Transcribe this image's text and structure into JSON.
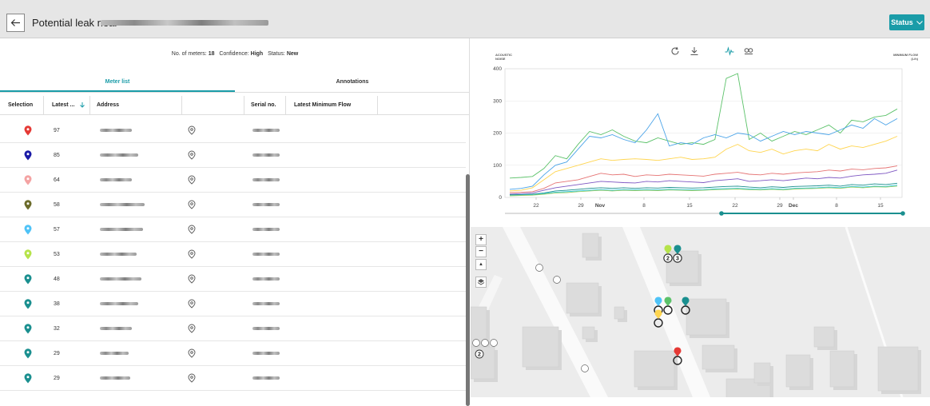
{
  "header": {
    "title": "Potential leak near",
    "status_button": "Status"
  },
  "summary": {
    "meters_label": "No. of meters:",
    "meters_value": "18",
    "confidence_label": "Confidence:",
    "confidence_value": "High",
    "status_label": "Status:",
    "status_value": "New"
  },
  "tabs": [
    {
      "label": "Meter list",
      "active": true
    },
    {
      "label": "Annotations",
      "active": false
    }
  ],
  "table": {
    "columns": [
      "Selection",
      "Latest ...",
      "Address",
      "",
      "Serial no.",
      "Latest Minimum Flow"
    ],
    "rows": [
      {
        "color": "#e53935",
        "value": "97"
      },
      {
        "color": "#1a1aa6",
        "value": "85"
      },
      {
        "color": "#f4a3a3",
        "value": "64"
      },
      {
        "color": "#6b6b2a",
        "value": "58"
      },
      {
        "color": "#4fc3f7",
        "value": "57"
      },
      {
        "color": "#b5e34a",
        "value": "53"
      },
      {
        "color": "#1a8f8f",
        "value": "48"
      },
      {
        "color": "#1a8f8f",
        "value": "38"
      },
      {
        "color": "#1a8f8f",
        "value": "32"
      },
      {
        "color": "#1a8f8f",
        "value": "29"
      },
      {
        "color": "#1a8f8f",
        "value": "29"
      }
    ]
  },
  "chart": {
    "left_axis_title": "ACOUSTIC NOISE",
    "right_axis_title": "MINIMUM FLOW (L/h)"
  },
  "chart_data": {
    "type": "line",
    "ylim": [
      0,
      400
    ],
    "yticks": [
      0,
      100,
      200,
      300,
      400
    ],
    "xtick_labels": [
      "22",
      "29",
      "Nov",
      "8",
      "15",
      "22",
      "29",
      "Dec",
      "8",
      "15"
    ],
    "grid": true,
    "series": [
      {
        "color": "#5cc26a",
        "values": [
          60,
          62,
          65,
          90,
          130,
          120,
          165,
          205,
          195,
          210,
          190,
          175,
          170,
          185,
          175,
          165,
          170,
          165,
          180,
          370,
          385,
          180,
          200,
          175,
          190,
          205,
          195,
          210,
          225,
          200,
          240,
          235,
          250,
          255,
          275
        ]
      },
      {
        "color": "#4aa3e8",
        "values": [
          25,
          28,
          35,
          70,
          100,
          110,
          150,
          190,
          185,
          195,
          180,
          170,
          210,
          260,
          160,
          170,
          165,
          185,
          195,
          185,
          200,
          195,
          175,
          190,
          205,
          195,
          205,
          200,
          195,
          210,
          225,
          215,
          245,
          225,
          245
        ]
      },
      {
        "color": "#ffd54f",
        "values": [
          20,
          22,
          30,
          55,
          80,
          90,
          100,
          110,
          120,
          115,
          118,
          120,
          118,
          115,
          120,
          125,
          118,
          120,
          125,
          150,
          165,
          145,
          140,
          150,
          135,
          145,
          150,
          145,
          165,
          150,
          160,
          155,
          165,
          175,
          190
        ]
      },
      {
        "color": "#e57373",
        "values": [
          15,
          16,
          18,
          28,
          45,
          50,
          55,
          65,
          75,
          70,
          72,
          65,
          70,
          68,
          72,
          70,
          68,
          66,
          72,
          75,
          78,
          72,
          70,
          75,
          72,
          76,
          78,
          80,
          85,
          82,
          88,
          86,
          90,
          92,
          98
        ]
      },
      {
        "color": "#7e57c2",
        "values": [
          10,
          12,
          14,
          22,
          30,
          35,
          40,
          45,
          50,
          48,
          46,
          45,
          50,
          48,
          52,
          50,
          48,
          46,
          52,
          55,
          58,
          50,
          52,
          55,
          52,
          56,
          60,
          58,
          62,
          60,
          66,
          70,
          72,
          75,
          85
        ]
      },
      {
        "color": "#1a8f8f",
        "values": [
          8,
          9,
          10,
          14,
          20,
          22,
          25,
          28,
          30,
          28,
          30,
          28,
          30,
          29,
          31,
          30,
          29,
          30,
          32,
          34,
          35,
          32,
          30,
          33,
          31,
          34,
          35,
          36,
          38,
          35,
          40,
          38,
          42,
          40,
          44
        ]
      },
      {
        "color": "#26c6da",
        "values": [
          6,
          7,
          8,
          12,
          16,
          18,
          20,
          22,
          24,
          22,
          24,
          23,
          24,
          23,
          25,
          24,
          23,
          24,
          26,
          27,
          28,
          26,
          25,
          27,
          25,
          28,
          29,
          30,
          32,
          30,
          34,
          32,
          35,
          34,
          38
        ]
      },
      {
        "color": "#9ccc65",
        "values": [
          5,
          6,
          7,
          10,
          14,
          15,
          18,
          20,
          22,
          20,
          22,
          21,
          22,
          21,
          23,
          22,
          21,
          22,
          24,
          25,
          26,
          24,
          23,
          25,
          23,
          26,
          27,
          28,
          30,
          28,
          32,
          30,
          33,
          32,
          35
        ]
      }
    ]
  },
  "map": {
    "zoom_in": "+",
    "zoom_out": "−",
    "north": "▲",
    "layers": "layers",
    "cluster_labels": [
      "2",
      "3",
      "2"
    ]
  }
}
